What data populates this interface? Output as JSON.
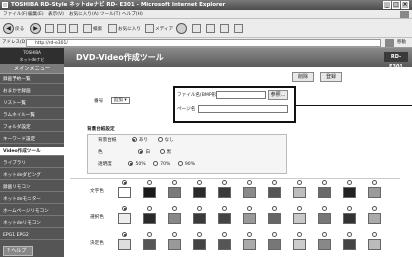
{
  "window": {
    "title": "TOSHIBA RD-Style ネットdeナビ  RD- E301 - Microsoft Internet Explorer"
  },
  "menu": [
    "ファイル(F)",
    "編集(E)",
    "表示(V)",
    "お気に入り(A)",
    "ツール(T)",
    "ヘルプ(H)"
  ],
  "toolbar": {
    "back": "戻る",
    "search": "検索",
    "favorites": "お気に入り",
    "media": "メディア"
  },
  "address": {
    "label": "アドレス(D)",
    "value": "http://rd-e301/",
    "go": "移動"
  },
  "sidebar": {
    "logo": "TOSHIBA\nネットdeナビ",
    "main_menu": "メインメニュー",
    "items": [
      "録画予約一覧",
      "おまかせ録画",
      "リスト一覧",
      "ラムネイル一覧",
      "フォルダ設定",
      "キーワード設定",
      "Video作成ツール",
      "ライブラリ",
      "ネットdeダビング",
      "録画リモコン",
      "ネットdeモニター",
      "ホームページリモコン",
      "ネットdeリモコン",
      "EPG1  EPG2"
    ],
    "active_index": 6,
    "help": "ヘルプ"
  },
  "page": {
    "title": "DVD-Video作成ツール",
    "model": "RD-E301",
    "delete_button": "削除",
    "register_button": "登録",
    "number_label": "番号",
    "number_select": "追加",
    "filename_label": "ファイル名(BMP形式)",
    "browse_button": "参照...",
    "menu_name_label": "ページ名",
    "bg_section": "背景台紙設定",
    "bg_row": {
      "label": "背景台紙",
      "opt1": "あり",
      "opt2": "なし"
    },
    "color_row": {
      "label": "色",
      "opt1": "白",
      "opt2": "黒"
    },
    "opacity_row": {
      "label": "透明度",
      "opt1": "50%",
      "opt2": "70%",
      "opt3": "90%"
    },
    "text_color_label": "文字色",
    "select_color_label": "選択色",
    "decide_color_label": "決定色"
  },
  "swatches": {
    "text": [
      "#ffffff",
      "#1a1a1a",
      "#7a7a7a",
      "#2a2a2a",
      "#3a3a3a",
      "#8a8a8a",
      "#555555",
      "#bdbdbd",
      "#6a6a6a",
      "#222222",
      "#9a9a9a"
    ],
    "select": [
      "#eeeeee",
      "#2a2a2a",
      "#888888",
      "#3a3a3a",
      "#444444",
      "#999999",
      "#666666",
      "#c8c8c8",
      "#777777",
      "#333333",
      "#aaaaaa"
    ],
    "decide": [
      "#dddddd",
      "#555555",
      "#999999",
      "#444444",
      "#555555",
      "#aaaaaa",
      "#777777",
      "#cccccc",
      "#888888",
      "#444444",
      "#bbbbbb"
    ]
  }
}
